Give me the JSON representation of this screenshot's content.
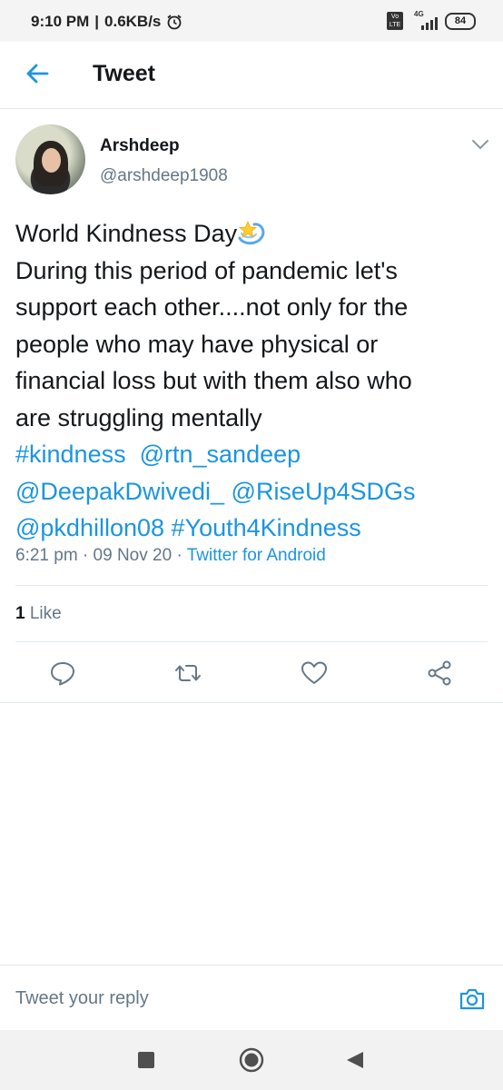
{
  "status_bar": {
    "time": "9:10 PM",
    "speed": "0.6KB/s",
    "network": "4G",
    "volte": "Vo LTE",
    "battery": "84"
  },
  "header": {
    "title": "Tweet"
  },
  "tweet": {
    "author": {
      "name": "Arshdeep",
      "handle": "@arshdeep1908"
    },
    "text_lines": [
      "World Kindness Day",
      "During this period of pandemic let's",
      "support each other....not only for the",
      "people who may have physical or",
      "financial loss but with them also who",
      "are struggling mentally"
    ],
    "tags": {
      "kindness": "#kindness",
      "rtn": "@rtn_sandeep",
      "deepak": "@DeepakDwivedi_",
      "riseup": "@RiseUp4SDGs",
      "pk": "@pkdhillon08",
      "youth": "#Youth4Kindness"
    },
    "time": "6:21 pm",
    "date": "09 Nov 20",
    "source": "Twitter for Android",
    "likes_count": "1",
    "likes_label": "Like"
  },
  "reply": {
    "placeholder": "Tweet your reply"
  },
  "colors": {
    "accent": "#1b95e0",
    "secondary_text": "#657786",
    "divider": "#e1e8ed"
  },
  "icons": {
    "back": "arrow-left-icon",
    "caret": "chevron-down-icon",
    "reply": "reply-bubble-icon",
    "retweet": "retweet-icon",
    "like": "heart-icon",
    "share": "share-icon",
    "camera": "camera-icon"
  }
}
